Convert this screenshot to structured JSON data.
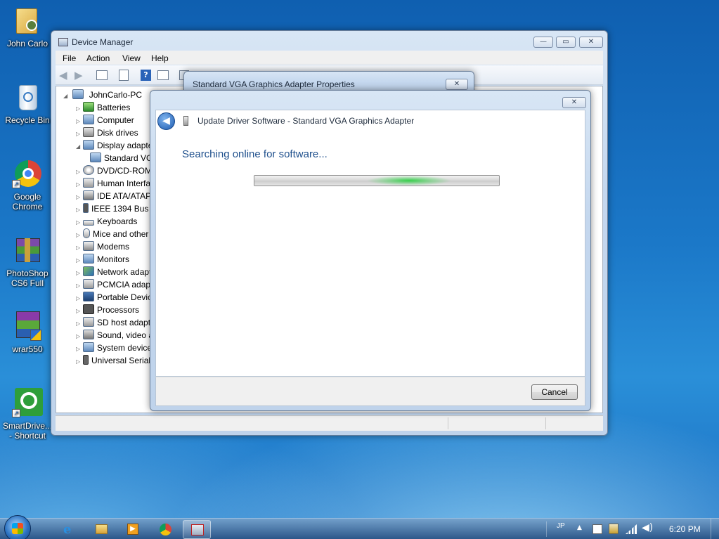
{
  "desktop": {
    "icons": [
      {
        "label_line1": "John Carlo",
        "label_line2": "",
        "icon": "user-folder-icon"
      },
      {
        "label_line1": "Recycle Bin",
        "label_line2": "",
        "icon": "recycle-bin-icon"
      },
      {
        "label_line1": "Google",
        "label_line2": "Chrome",
        "icon": "chrome-icon"
      },
      {
        "label_line1": "PhotoShop",
        "label_line2": "CS6 Full",
        "icon": "winrar-archive-icon"
      },
      {
        "label_line1": "wrar550",
        "label_line2": "",
        "icon": "winrar-installer-icon"
      },
      {
        "label_line1": "SmartDrive...",
        "label_line2": "- Shortcut",
        "icon": "smartdriver-shortcut-icon"
      }
    ]
  },
  "device_manager": {
    "title": "Device Manager",
    "menu": [
      "File",
      "Action",
      "View",
      "Help"
    ],
    "tree_root": "JohnCarlo-PC",
    "tree_items": [
      {
        "label": "Batteries",
        "expanded": false
      },
      {
        "label": "Computer",
        "expanded": false
      },
      {
        "label": "Disk drives",
        "expanded": false
      },
      {
        "label": "Display adapters",
        "expanded": true
      },
      {
        "label": "Standard VGA Graphics Adapter",
        "child": true
      },
      {
        "label": "DVD/CD-ROM drives",
        "expanded": false
      },
      {
        "label": "Human Interface Devices",
        "expanded": false
      },
      {
        "label": "IDE ATA/ATAPI controllers",
        "expanded": false
      },
      {
        "label": "IEEE 1394 Bus host controllers",
        "expanded": false
      },
      {
        "label": "Keyboards",
        "expanded": false
      },
      {
        "label": "Mice and other pointing devices",
        "expanded": false
      },
      {
        "label": "Modems",
        "expanded": false
      },
      {
        "label": "Monitors",
        "expanded": false
      },
      {
        "label": "Network adapters",
        "expanded": false
      },
      {
        "label": "PCMCIA adapters",
        "expanded": false
      },
      {
        "label": "Portable Devices",
        "expanded": false
      },
      {
        "label": "Processors",
        "expanded": false
      },
      {
        "label": "SD host adapters",
        "expanded": false
      },
      {
        "label": "Sound, video and game controllers",
        "expanded": false
      },
      {
        "label": "System devices",
        "expanded": false
      },
      {
        "label": "Universal Serial Bus controllers",
        "expanded": false
      }
    ]
  },
  "properties_dialog": {
    "title": "Standard VGA Graphics Adapter Properties"
  },
  "wizard": {
    "title": "Update Driver Software - Standard VGA Graphics Adapter",
    "status": "Searching online for software...",
    "cancel_label": "Cancel",
    "progress_state": "indeterminate"
  },
  "taskbar": {
    "language": "JP",
    "time": "6:20 PM",
    "apps": [
      "internet-explorer-icon",
      "windows-explorer-icon",
      "media-player-icon",
      "chrome-icon",
      "device-manager-icon"
    ]
  },
  "colors": {
    "wizard_heading": "#1e4f8c",
    "progress_green": "#35d04a"
  }
}
